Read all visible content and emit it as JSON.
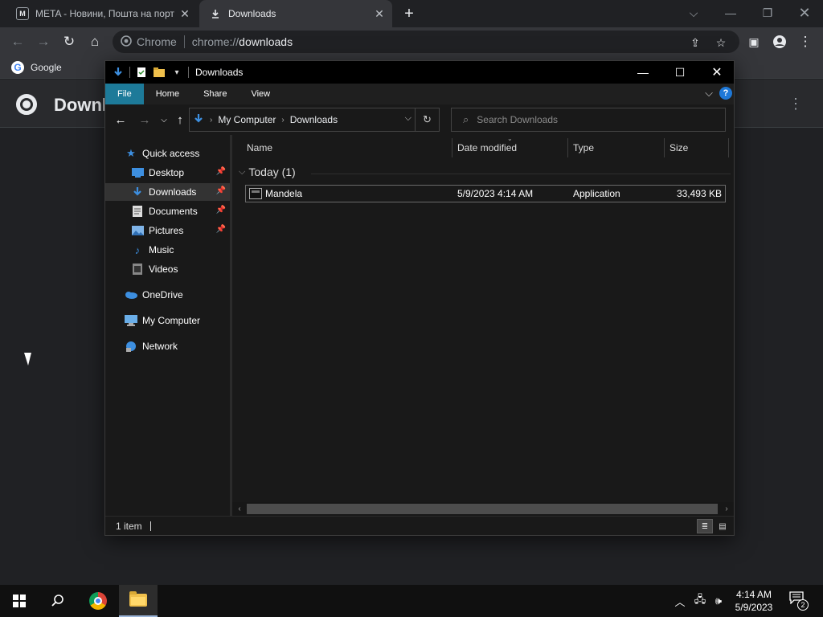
{
  "browser": {
    "tabs": [
      {
        "favicon": "M",
        "title": "META - Новини, Пошта на порт"
      },
      {
        "title": "Downloads"
      }
    ],
    "omnibox": {
      "site_label": "Chrome",
      "url_prefix": "chrome://",
      "url_path": "downloads"
    },
    "bookmarks": [
      {
        "label": "Google"
      }
    ],
    "page": {
      "title": "Downloads"
    }
  },
  "explorer": {
    "window_title": "Downloads",
    "ribbon_tabs": [
      "File",
      "Home",
      "Share",
      "View"
    ],
    "breadcrumb": [
      "My Computer",
      "Downloads"
    ],
    "search_placeholder": "Search Downloads",
    "nav": {
      "quick_access": "Quick access",
      "items": [
        {
          "label": "Desktop",
          "pinned": true
        },
        {
          "label": "Downloads",
          "pinned": true,
          "selected": true
        },
        {
          "label": "Documents",
          "pinned": true
        },
        {
          "label": "Pictures",
          "pinned": true
        },
        {
          "label": "Music"
        },
        {
          "label": "Videos"
        }
      ],
      "onedrive": "OneDrive",
      "my_computer": "My Computer",
      "network": "Network"
    },
    "columns": [
      "Name",
      "Date modified",
      "Type",
      "Size"
    ],
    "group": "Today (1)",
    "files": [
      {
        "name": "Mandela",
        "date_modified": "5/9/2023 4:14 AM",
        "type": "Application",
        "size": "33,493 KB"
      }
    ],
    "status": "1 item"
  },
  "taskbar": {
    "clock_time": "4:14 AM",
    "clock_date": "5/9/2023",
    "notification_count": "2"
  },
  "colors": {
    "chrome_bg": "#202124",
    "chrome_toolbar": "#35363a",
    "explorer_bg": "#191919",
    "ribbon_file_tab": "#1d7a99",
    "accent_blue": "#1e78d7"
  }
}
